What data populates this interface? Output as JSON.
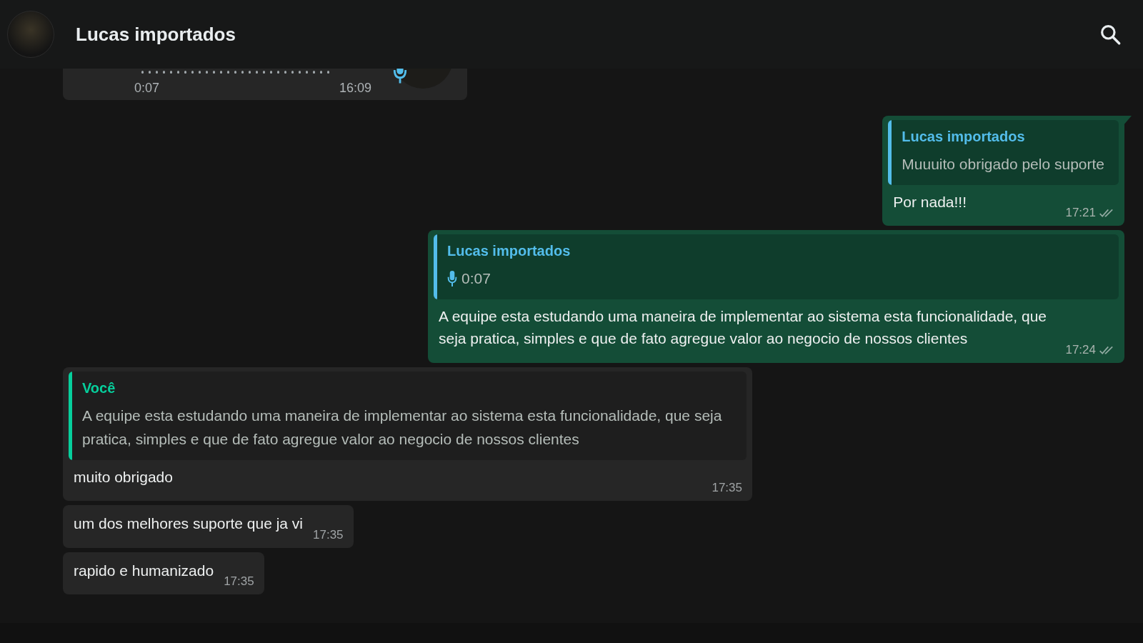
{
  "header": {
    "title": "Lucas importados"
  },
  "top_audio": {
    "duration": "0:07",
    "time": "16:09"
  },
  "messages": [
    {
      "kind": "outgoing",
      "tail": true,
      "quote": {
        "kind": "text",
        "author": "Lucas importados",
        "color": "#53bdeb",
        "text": "Muuuito obrigado pelo suporte"
      },
      "text": "Por nada!!!",
      "time": "17:21",
      "read": false
    },
    {
      "kind": "outgoing",
      "tail": false,
      "quote": {
        "kind": "audio",
        "author": "Lucas importados",
        "color": "#53bdeb",
        "text": "0:07"
      },
      "text": "A equipe esta estudando uma maneira de implementar ao sistema esta funcionalidade, que seja pratica, simples e que de fato agregue valor ao negocio de nossos clientes",
      "time": "17:24",
      "read": false
    },
    {
      "kind": "incoming",
      "tail": false,
      "quote": {
        "kind": "text",
        "author": "Você",
        "color": "#06cf9c",
        "text": "A equipe esta estudando uma maneira de implementar ao sistema esta funcionalidade, que seja pratica, simples e que de fato agregue valor ao negocio de nossos clientes"
      },
      "text": "muito obrigado",
      "time": "17:35"
    },
    {
      "kind": "incoming",
      "tail": false,
      "text": "um dos melhores suporte que ja vi",
      "time": "17:35"
    },
    {
      "kind": "incoming",
      "tail": false,
      "text": "rapido e humanizado",
      "time": "17:35"
    }
  ]
}
